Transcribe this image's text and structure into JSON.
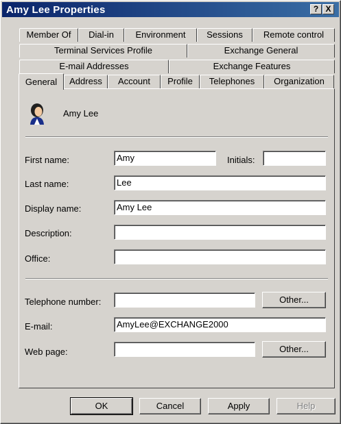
{
  "window": {
    "title": "Amy Lee Properties"
  },
  "titlebar_buttons": {
    "help": "?",
    "close": "X"
  },
  "tabs": {
    "row1": [
      "Member Of",
      "Dial-in",
      "Environment",
      "Sessions",
      "Remote control"
    ],
    "row2": [
      "Terminal Services Profile",
      "Exchange General"
    ],
    "row3": [
      "E-mail Addresses",
      "Exchange Features"
    ],
    "row4": [
      "General",
      "Address",
      "Account",
      "Profile",
      "Telephones",
      "Organization"
    ],
    "active": "General"
  },
  "user": {
    "display_name": "Amy Lee",
    "icon": "user-icon"
  },
  "form": {
    "first_name": {
      "label": "First name:",
      "value": "Amy"
    },
    "initials": {
      "label": "Initials:",
      "value": ""
    },
    "last_name": {
      "label": "Last name:",
      "value": "Lee"
    },
    "display_name": {
      "label": "Display name:",
      "value": "Amy Lee"
    },
    "description": {
      "label": "Description:",
      "value": ""
    },
    "office": {
      "label": "Office:",
      "value": ""
    },
    "telephone": {
      "label": "Telephone number:",
      "value": "",
      "other_button": "Other..."
    },
    "email": {
      "label": "E-mail:",
      "value": "AmyLee@EXCHANGE2000"
    },
    "web_page": {
      "label": "Web page:",
      "value": "",
      "other_button": "Other..."
    }
  },
  "buttons": {
    "ok": "OK",
    "cancel": "Cancel",
    "apply": "Apply",
    "help": "Help"
  }
}
